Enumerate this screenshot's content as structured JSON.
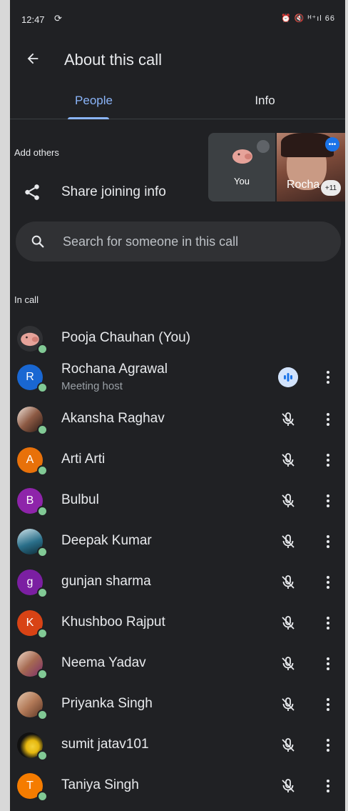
{
  "status_bar": {
    "time": "12:47",
    "right_indicators": "⏰ 🔇 ᴴ⁺ıl 66"
  },
  "header": {
    "title": "About this call"
  },
  "tabs": [
    {
      "label": "People",
      "selected": true
    },
    {
      "label": "Info",
      "selected": false
    }
  ],
  "add_others": {
    "heading": "Add others",
    "share_label": "Share joining info"
  },
  "tiles": {
    "you_label": "You",
    "rochana_label": "Rocha",
    "more_count": "+11"
  },
  "search": {
    "placeholder": "Search for someone in this call"
  },
  "in_call_heading": "In call",
  "participants": [
    {
      "name": "Pooja Chauhan (You)",
      "avatar": "pig-image",
      "color": "#5f6368",
      "mic": "none"
    },
    {
      "name": "Rochana Agrawal",
      "subtitle": "Meeting host",
      "avatar_letter": "R",
      "color": "#1967d2",
      "mic": "speaking"
    },
    {
      "name": "Akansha Raghav",
      "avatar": "photo",
      "color": "#6d4c41",
      "mic": "muted"
    },
    {
      "name": "Arti Arti",
      "avatar_letter": "A",
      "color": "#e8710a",
      "mic": "muted"
    },
    {
      "name": "Bulbul",
      "avatar_letter": "B",
      "color": "#8e24aa",
      "mic": "muted"
    },
    {
      "name": "Deepak Kumar",
      "avatar": "photo",
      "color": "#2a6f8a",
      "mic": "muted"
    },
    {
      "name": "gunjan sharma",
      "avatar_letter": "g",
      "color": "#7b1fa2",
      "mic": "muted"
    },
    {
      "name": "Khushboo Rajput",
      "avatar_letter": "K",
      "color": "#d84315",
      "mic": "muted"
    },
    {
      "name": "Neema Yadav",
      "avatar": "photo",
      "color": "#8d6e63",
      "mic": "muted"
    },
    {
      "name": "Priyanka Singh",
      "avatar": "photo",
      "color": "#a1887f",
      "mic": "muted"
    },
    {
      "name": "sumit jatav101",
      "avatar": "photo",
      "color": "#111111",
      "mic": "muted"
    },
    {
      "name": "Taniya Singh",
      "avatar_letter": "T",
      "color": "#f57c00",
      "mic": "muted"
    }
  ],
  "colors": {
    "background": "#202124",
    "accent": "#8ab4f8",
    "online": "#81c995"
  }
}
